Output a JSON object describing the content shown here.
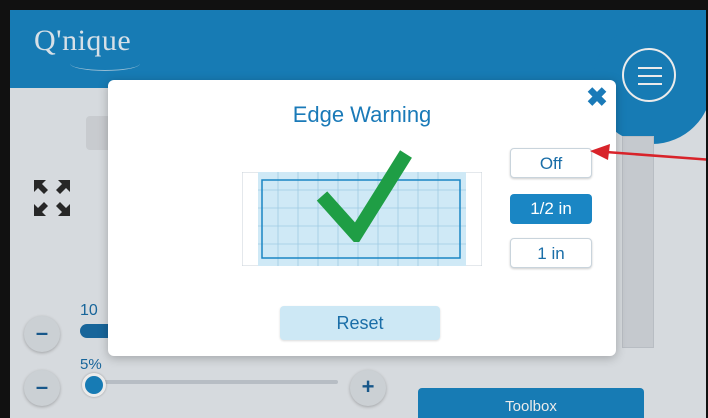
{
  "app": {
    "logo": "Q'nique"
  },
  "background": {
    "zoom_value": "10",
    "slider_value": "5%",
    "minus_symbol": "–",
    "plus_symbol": "+",
    "toolbox_label": "Toolbox"
  },
  "modal": {
    "title": "Edge Warning",
    "close_symbol": "✖",
    "options": [
      "Off",
      "1/2 in",
      "1 in"
    ],
    "selected_option": "1/2 in",
    "reset_label": "Reset",
    "status_icon": "checkmark-icon"
  },
  "colors": {
    "accent": "#1a86c4",
    "check": "#1f9e45",
    "annotation_arrow": "#d8232a"
  }
}
